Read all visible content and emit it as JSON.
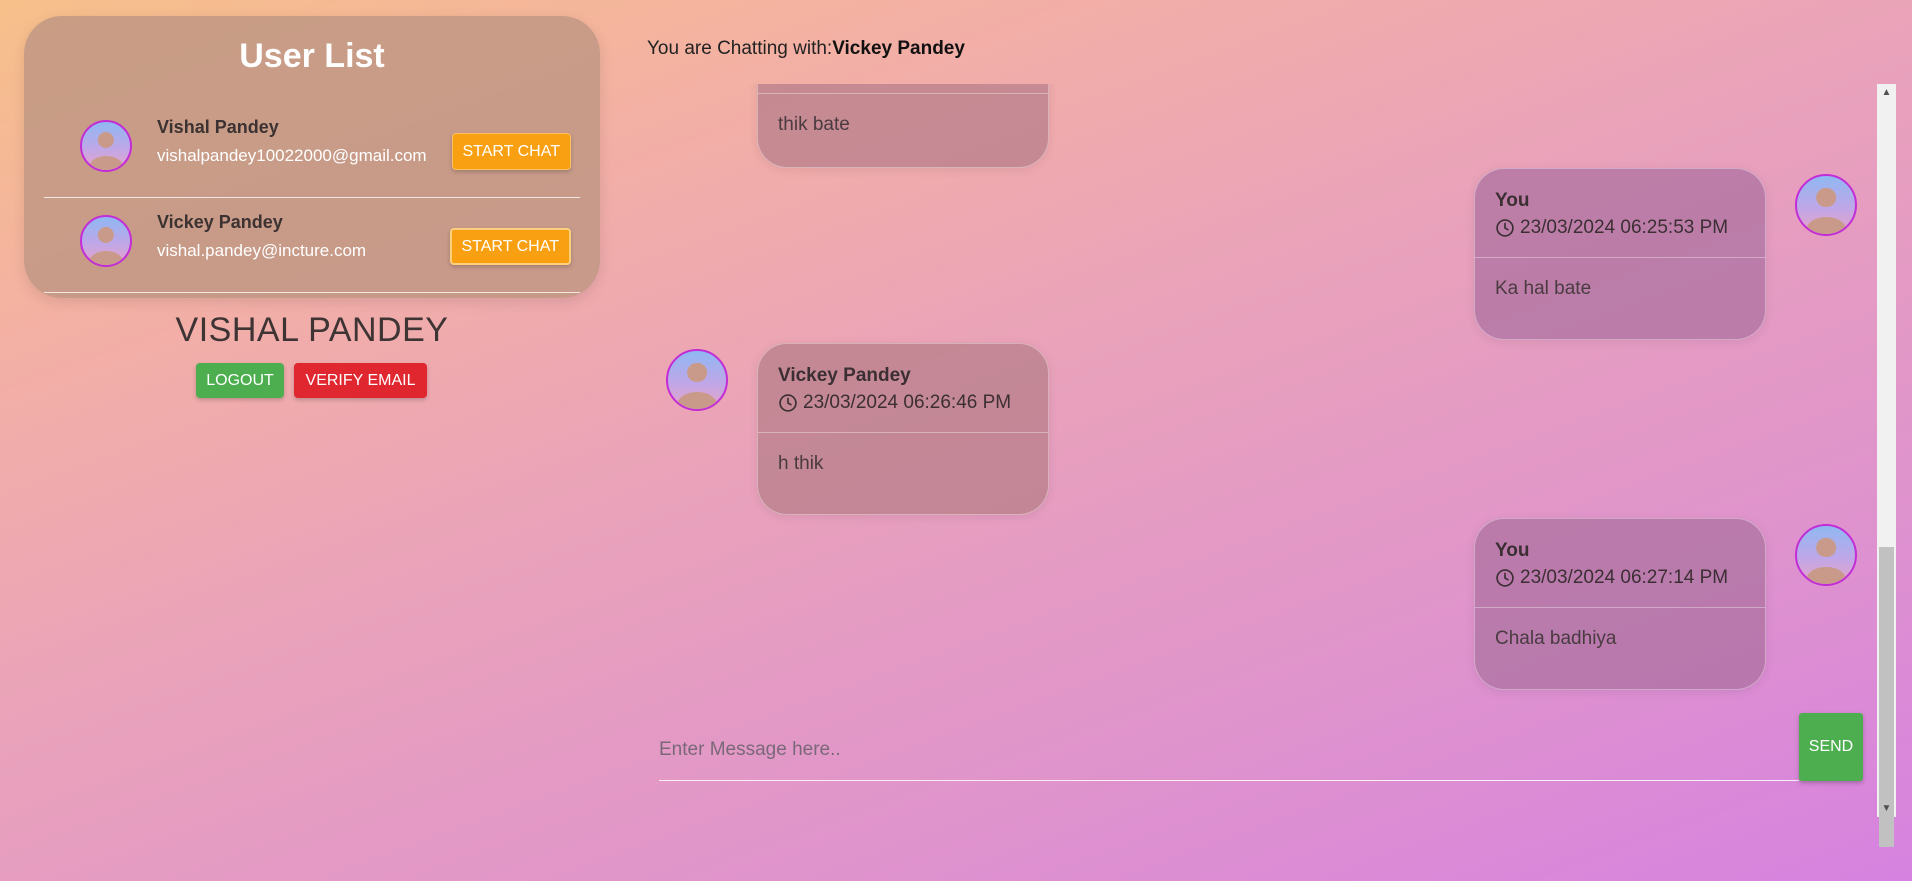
{
  "sidebar": {
    "title": "User List",
    "users": [
      {
        "name": "Vishal Pandey",
        "email": "vishalpandey10022000@gmail.com",
        "button": "START CHAT"
      },
      {
        "name": "Vickey Pandey",
        "email": "vishal.pandey@incture.com",
        "button": "START CHAT"
      }
    ],
    "current_user": "VISHAL PANDEY",
    "logout_label": "LOGOUT",
    "verify_label": "VERIFY EMAIL"
  },
  "chat": {
    "header_prefix": "You are Chatting with:",
    "partner": "Vickey Pandey",
    "messages": [
      {
        "text": "thik bate"
      },
      {
        "sender": "You",
        "time": "23/03/2024 06:25:53 PM",
        "text": "Ka hal bate"
      },
      {
        "sender": "Vickey Pandey",
        "time": "23/03/2024 06:26:46 PM",
        "text": "h thik"
      },
      {
        "sender": "You",
        "time": "23/03/2024 06:27:14 PM",
        "text": "Chala badhiya"
      }
    ],
    "input_placeholder": "Enter Message here..",
    "send_label": "SEND"
  },
  "colors": {
    "start_chat": "#f9a012",
    "logout": "#4cae4f",
    "verify": "#e0262e",
    "send": "#4cae4f",
    "avatar_ring": "#c22dd6"
  },
  "icons": [
    "user-avatar-icon",
    "clock-icon",
    "scroll-up-arrow-icon",
    "scroll-down-arrow-icon"
  ]
}
